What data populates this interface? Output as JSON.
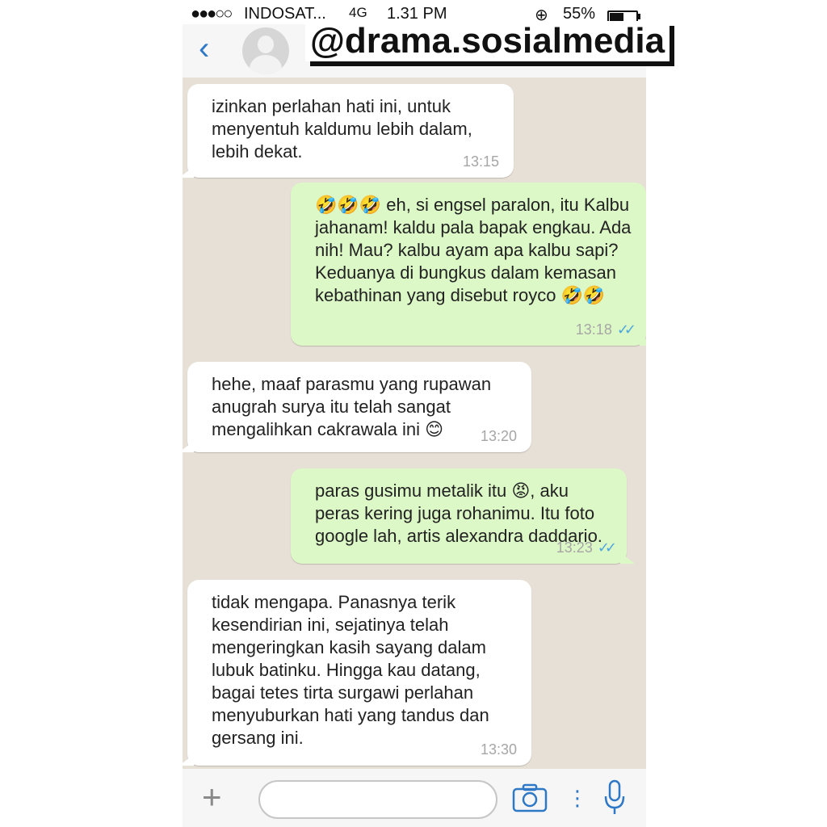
{
  "status_bar": {
    "signal": "●●●○○",
    "carrier": "INDOSAT...",
    "network": "4G",
    "time": "1.31 PM",
    "battery_pct": "55%",
    "battery_level": 0.55
  },
  "watermark": "@drama.sosialmedia",
  "messages": [
    {
      "direction": "incoming",
      "text": "izinkan perlahan hati ini, untuk menyentuh kaldumu lebih dalam, lebih dekat.",
      "time": "13:15"
    },
    {
      "direction": "outgoing",
      "text": "🤣🤣🤣 eh, si engsel paralon, itu Kalbu jahanam! kaldu pala bapak engkau. Ada nih! Mau? kalbu ayam apa kalbu sapi? Keduanya di bungkus dalam kemasan kebathinan yang disebut royco 🤣🤣",
      "time": "13:18",
      "status": "read"
    },
    {
      "direction": "incoming",
      "text": "hehe, maaf parasmu yang rupawan anugrah surya itu telah sangat mengalihkan cakrawala ini 😊",
      "time": "13:20"
    },
    {
      "direction": "outgoing",
      "text": "paras gusimu metalik itu 😡, aku peras kering juga rohanimu. Itu foto google lah, artis alexandra daddario.",
      "time": "13:23",
      "status": "read"
    },
    {
      "direction": "incoming",
      "text": "tidak mengapa. Panasnya terik kesendirian ini, sejatinya telah mengeringkan kasih sayang dalam lubuk batinku. Hingga kau datang, bagai tetes tirta surgawi perlahan menyuburkan hati yang tandus dan gersang ini.",
      "time": "13:30"
    }
  ],
  "colors": {
    "incoming_bubble": "#ffffff",
    "outgoing_bubble": "#dcf8c6",
    "chat_background": "#e7e0d6",
    "accent": "#2f78c6",
    "read_ticks": "#4fa7e0"
  },
  "icons": {
    "back": "chevron-left-icon",
    "plus": "plus-icon",
    "camera": "camera-icon",
    "more": "more-dots-icon",
    "mic": "microphone-icon",
    "read": "double-check-icon"
  },
  "input": {
    "value": ""
  }
}
